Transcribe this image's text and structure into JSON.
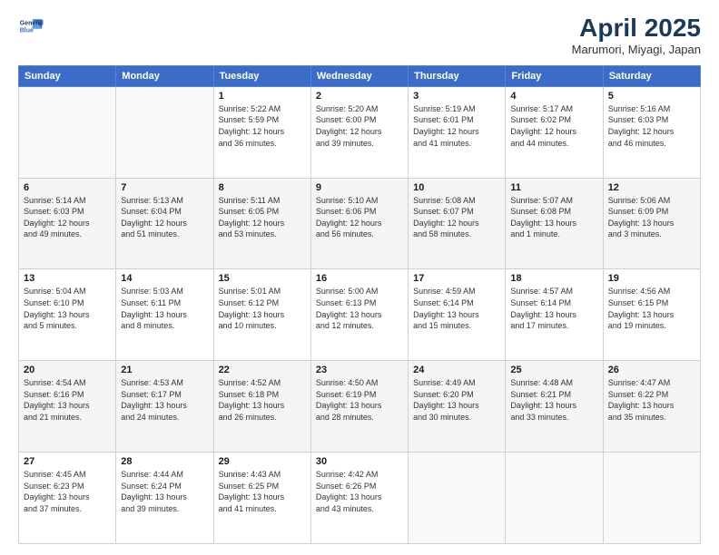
{
  "logo": {
    "line1": "General",
    "line2": "Blue"
  },
  "title": "April 2025",
  "location": "Marumori, Miyagi, Japan",
  "weekdays": [
    "Sunday",
    "Monday",
    "Tuesday",
    "Wednesday",
    "Thursday",
    "Friday",
    "Saturday"
  ],
  "weeks": [
    [
      {
        "day": "",
        "info": ""
      },
      {
        "day": "",
        "info": ""
      },
      {
        "day": "1",
        "info": "Sunrise: 5:22 AM\nSunset: 5:59 PM\nDaylight: 12 hours\nand 36 minutes."
      },
      {
        "day": "2",
        "info": "Sunrise: 5:20 AM\nSunset: 6:00 PM\nDaylight: 12 hours\nand 39 minutes."
      },
      {
        "day": "3",
        "info": "Sunrise: 5:19 AM\nSunset: 6:01 PM\nDaylight: 12 hours\nand 41 minutes."
      },
      {
        "day": "4",
        "info": "Sunrise: 5:17 AM\nSunset: 6:02 PM\nDaylight: 12 hours\nand 44 minutes."
      },
      {
        "day": "5",
        "info": "Sunrise: 5:16 AM\nSunset: 6:03 PM\nDaylight: 12 hours\nand 46 minutes."
      }
    ],
    [
      {
        "day": "6",
        "info": "Sunrise: 5:14 AM\nSunset: 6:03 PM\nDaylight: 12 hours\nand 49 minutes."
      },
      {
        "day": "7",
        "info": "Sunrise: 5:13 AM\nSunset: 6:04 PM\nDaylight: 12 hours\nand 51 minutes."
      },
      {
        "day": "8",
        "info": "Sunrise: 5:11 AM\nSunset: 6:05 PM\nDaylight: 12 hours\nand 53 minutes."
      },
      {
        "day": "9",
        "info": "Sunrise: 5:10 AM\nSunset: 6:06 PM\nDaylight: 12 hours\nand 56 minutes."
      },
      {
        "day": "10",
        "info": "Sunrise: 5:08 AM\nSunset: 6:07 PM\nDaylight: 12 hours\nand 58 minutes."
      },
      {
        "day": "11",
        "info": "Sunrise: 5:07 AM\nSunset: 6:08 PM\nDaylight: 13 hours\nand 1 minute."
      },
      {
        "day": "12",
        "info": "Sunrise: 5:06 AM\nSunset: 6:09 PM\nDaylight: 13 hours\nand 3 minutes."
      }
    ],
    [
      {
        "day": "13",
        "info": "Sunrise: 5:04 AM\nSunset: 6:10 PM\nDaylight: 13 hours\nand 5 minutes."
      },
      {
        "day": "14",
        "info": "Sunrise: 5:03 AM\nSunset: 6:11 PM\nDaylight: 13 hours\nand 8 minutes."
      },
      {
        "day": "15",
        "info": "Sunrise: 5:01 AM\nSunset: 6:12 PM\nDaylight: 13 hours\nand 10 minutes."
      },
      {
        "day": "16",
        "info": "Sunrise: 5:00 AM\nSunset: 6:13 PM\nDaylight: 13 hours\nand 12 minutes."
      },
      {
        "day": "17",
        "info": "Sunrise: 4:59 AM\nSunset: 6:14 PM\nDaylight: 13 hours\nand 15 minutes."
      },
      {
        "day": "18",
        "info": "Sunrise: 4:57 AM\nSunset: 6:14 PM\nDaylight: 13 hours\nand 17 minutes."
      },
      {
        "day": "19",
        "info": "Sunrise: 4:56 AM\nSunset: 6:15 PM\nDaylight: 13 hours\nand 19 minutes."
      }
    ],
    [
      {
        "day": "20",
        "info": "Sunrise: 4:54 AM\nSunset: 6:16 PM\nDaylight: 13 hours\nand 21 minutes."
      },
      {
        "day": "21",
        "info": "Sunrise: 4:53 AM\nSunset: 6:17 PM\nDaylight: 13 hours\nand 24 minutes."
      },
      {
        "day": "22",
        "info": "Sunrise: 4:52 AM\nSunset: 6:18 PM\nDaylight: 13 hours\nand 26 minutes."
      },
      {
        "day": "23",
        "info": "Sunrise: 4:50 AM\nSunset: 6:19 PM\nDaylight: 13 hours\nand 28 minutes."
      },
      {
        "day": "24",
        "info": "Sunrise: 4:49 AM\nSunset: 6:20 PM\nDaylight: 13 hours\nand 30 minutes."
      },
      {
        "day": "25",
        "info": "Sunrise: 4:48 AM\nSunset: 6:21 PM\nDaylight: 13 hours\nand 33 minutes."
      },
      {
        "day": "26",
        "info": "Sunrise: 4:47 AM\nSunset: 6:22 PM\nDaylight: 13 hours\nand 35 minutes."
      }
    ],
    [
      {
        "day": "27",
        "info": "Sunrise: 4:45 AM\nSunset: 6:23 PM\nDaylight: 13 hours\nand 37 minutes."
      },
      {
        "day": "28",
        "info": "Sunrise: 4:44 AM\nSunset: 6:24 PM\nDaylight: 13 hours\nand 39 minutes."
      },
      {
        "day": "29",
        "info": "Sunrise: 4:43 AM\nSunset: 6:25 PM\nDaylight: 13 hours\nand 41 minutes."
      },
      {
        "day": "30",
        "info": "Sunrise: 4:42 AM\nSunset: 6:26 PM\nDaylight: 13 hours\nand 43 minutes."
      },
      {
        "day": "",
        "info": ""
      },
      {
        "day": "",
        "info": ""
      },
      {
        "day": "",
        "info": ""
      }
    ]
  ]
}
